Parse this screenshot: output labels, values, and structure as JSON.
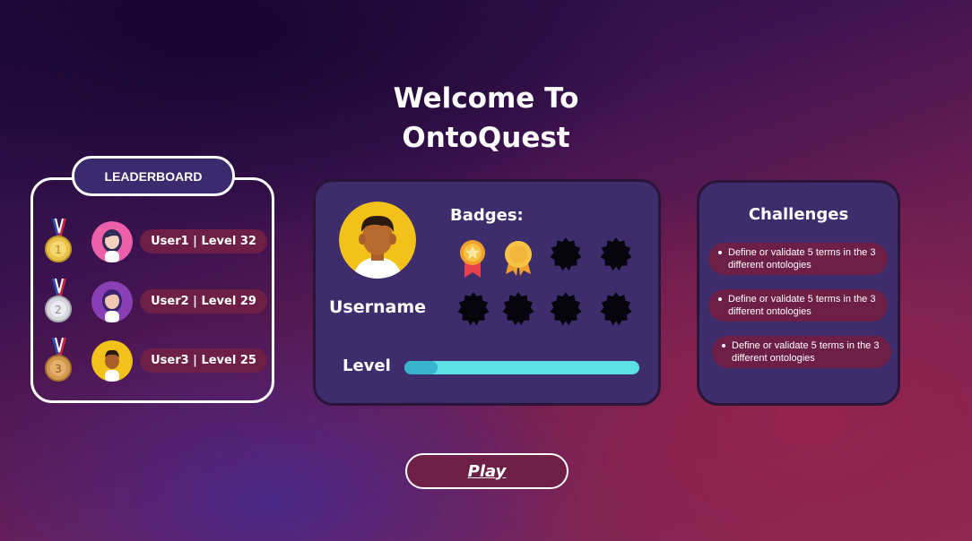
{
  "page": {
    "title_line1": "Welcome To",
    "title_line2": "OntoQuest"
  },
  "leaderboard": {
    "tab_label": "LEADERBOARD",
    "entries": [
      {
        "label": "User1 | Level 32",
        "medal": "gold-medal-icon",
        "avatar": "girl-pink-avatar"
      },
      {
        "label": "User2 | Level 29",
        "medal": "silver-medal-icon",
        "avatar": "girl-purple-avatar"
      },
      {
        "label": "User3 | Level 25",
        "medal": "bronze-medal-icon",
        "avatar": "boy-yellow-avatar"
      }
    ]
  },
  "profile": {
    "username": "Username",
    "badges_title": "Badges:",
    "badges": [
      {
        "name": "star-ribbon-badge",
        "earned": true
      },
      {
        "name": "gold-rosette-badge",
        "earned": true
      },
      {
        "name": "locked-badge",
        "earned": false
      },
      {
        "name": "locked-badge",
        "earned": false
      },
      {
        "name": "locked-badge",
        "earned": false
      },
      {
        "name": "locked-badge",
        "earned": false
      },
      {
        "name": "locked-badge",
        "earned": false
      },
      {
        "name": "locked-badge",
        "earned": false
      }
    ],
    "level_label": "Level",
    "level_progress": 0.14
  },
  "challenges": {
    "title": "Challenges",
    "items": [
      "Define or validate 5 terms in the 3 different ontologies",
      "Define or validate 5 terms in the 3 different ontologies",
      "Define or validate 5 terms in the 3 different ontologies"
    ]
  },
  "actions": {
    "play_label": "Play"
  },
  "colors": {
    "panel": "#3e2d6c",
    "pill": "#6e1f45",
    "progress_track": "#5ce0e6",
    "progress_fill": "#38b4cf"
  }
}
